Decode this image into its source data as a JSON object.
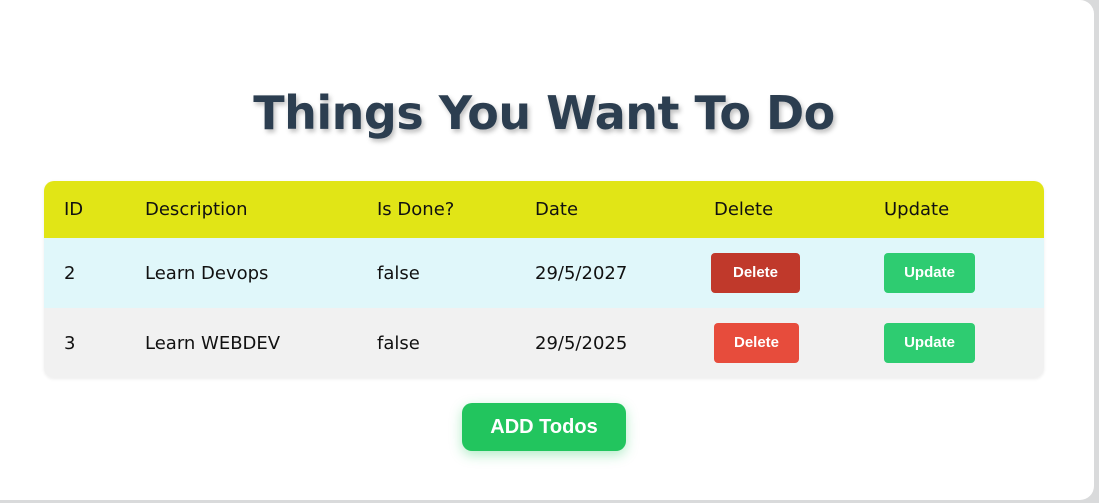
{
  "title": "Things You Want To Do",
  "table": {
    "headers": [
      "ID",
      "Description",
      "Is Done?",
      "Date",
      "Delete",
      "Update"
    ],
    "rows": [
      {
        "id": "2",
        "description": "Learn Devops",
        "is_done": "false",
        "date": "29/5/2027",
        "delete_label": "Delete",
        "update_label": "Update"
      },
      {
        "id": "3",
        "description": "Learn WEBDEV",
        "is_done": "false",
        "date": "29/5/2025",
        "delete_label": "Delete",
        "update_label": "Update"
      }
    ]
  },
  "add_button_label": "ADD Todos",
  "colors": {
    "header_bg": "#e1e516",
    "row1_bg": "#e0f7fa",
    "row2_bg": "#f1f1f1",
    "delete_active": "#c0392b",
    "delete": "#e74c3c",
    "update": "#2ecc71",
    "add": "#22c55e",
    "title": "#2c3e50"
  }
}
